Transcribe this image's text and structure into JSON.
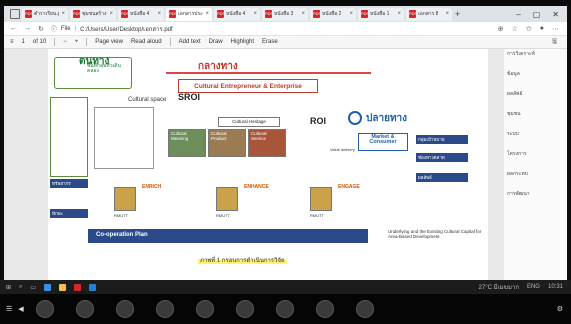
{
  "tabs": [
    {
      "label": "ตำราเรียน.pdf",
      "active": false
    },
    {
      "label": "ชุมชนสร้าง",
      "active": false
    },
    {
      "label": "หนังสือ 4",
      "active": false
    },
    {
      "label": "เอกสารประ",
      "active": true
    },
    {
      "label": "หนังสือ 4",
      "active": false
    },
    {
      "label": "หนังสือ 3",
      "active": false
    },
    {
      "label": "หนังสือ 2",
      "active": false
    },
    {
      "label": "หนังสือ 1",
      "active": false
    },
    {
      "label": "เอกสาร 8",
      "active": false
    }
  ],
  "address": {
    "label": "File",
    "url": "C:/Users/User/Desktop/เอกสาร.pdf"
  },
  "pdfbar": {
    "page_current": "1",
    "page_total": "of 10",
    "zoom_out": "−",
    "zoom_in": "+",
    "page_view": "Page view",
    "read_aloud": "Read aloud",
    "add_text": "Add text",
    "draw": "Draw",
    "highlight": "Highlight",
    "erase": "Erase"
  },
  "diagram": {
    "top_left_title": "ต้นทาง",
    "top_left_sub": "พื้นที่กลุ่มหัวเดินคลอง",
    "middle_title": "กลางทาง",
    "cultural_enterprise": "Cultural Entrepreneur & Enterprise",
    "cultural_space": "Cultural space",
    "sroi": "SROI",
    "roi": "ROI",
    "cultural_heritage": "Cultural Heritage",
    "downstream_title": "ปลายทาง",
    "market": "Market & Consumer",
    "value_delivery": "Value delivery",
    "enrich": "ENRICH",
    "enhance": "ENHANCE",
    "engage": "ENGAGE",
    "rmutt": "RMUTT",
    "coop_plan": "Co-operation Plan",
    "underlying": "Underlying and the Existing Cultural Capital for Area-Based Development",
    "caption": "ภาพที่ 1 กรอบการดำเนินการวิจัย"
  },
  "sidecol": {
    "lines": [
      "การวิเคราะห์",
      "ข้อมูล",
      "ผลลัพธ์",
      "ชุมชน",
      "ระบบ",
      "โครงการ",
      "ผลกระทบ",
      "การพัฒนา"
    ]
  },
  "taskbar": {
    "weather": "27°C มีเมฆมาก",
    "lang": "ENG",
    "time": "10:31"
  },
  "meeting": {
    "participants": 9
  }
}
